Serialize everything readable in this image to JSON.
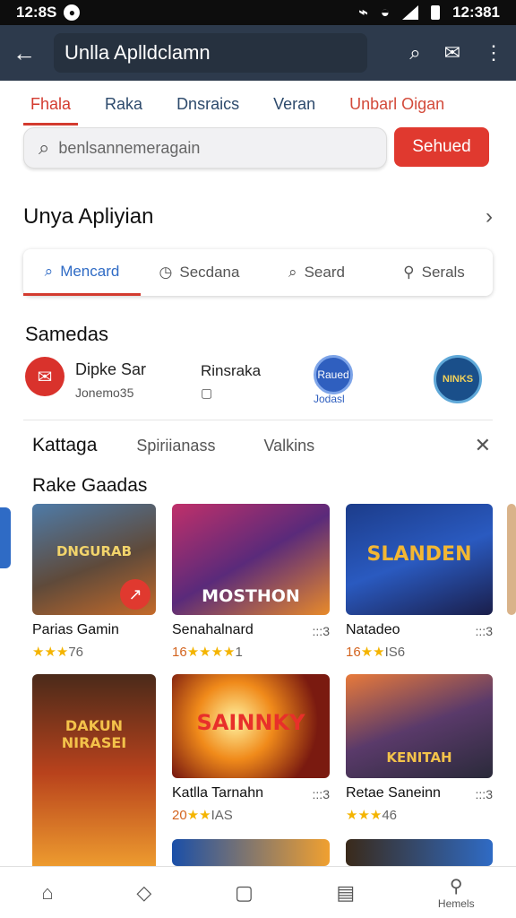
{
  "status": {
    "time_left": "12:8S",
    "time_right": "12:381"
  },
  "appbar": {
    "title": "Unlla Aplldclamn"
  },
  "tabs": [
    {
      "label": "Fhala",
      "active": true
    },
    {
      "label": "Raka"
    },
    {
      "label": "Dnsraics"
    },
    {
      "label": "Veran"
    },
    {
      "label": "Unbarl Oigan",
      "red": true
    }
  ],
  "search": {
    "value": "benlsannemeragain",
    "button": "Sehued"
  },
  "section1": {
    "title": "Unya Apliyian"
  },
  "segments": [
    {
      "label": "Mencard",
      "icon": "search-icon",
      "active": true
    },
    {
      "label": "Secdana",
      "icon": "clock-icon"
    },
    {
      "label": "Seard",
      "icon": "search-icon"
    },
    {
      "label": "Serals",
      "icon": "user-icon"
    }
  ],
  "games_title": "Samedas",
  "games_row": [
    {
      "name": "Dipke Sar",
      "sub": "Jonemo35",
      "color": "#d9322c"
    },
    {
      "name": "Rinsraka",
      "sub": "",
      "color": ""
    },
    {
      "name": "Raued",
      "sub": "Jodasl",
      "color": "#2f5fbf"
    },
    {
      "name": "NINKS",
      "sub": "",
      "color": "#1a4f8a"
    }
  ],
  "categories": {
    "first": "Kattaga",
    "items": [
      "Spiriianass",
      "Valkins"
    ]
  },
  "rake_title": "Rake Gaadas",
  "cards": [
    {
      "thumb_text": "DNGURAB",
      "name": "Parias Gamin",
      "rating_num": "",
      "rating_suffix": "76",
      "dots": ""
    },
    {
      "thumb_text": "MOSTHON",
      "name": "Senahalnard",
      "rating_num": "16",
      "rating_suffix": "1",
      "dots": ":::3"
    },
    {
      "thumb_text": "SLANDEN",
      "name": "Natadeo",
      "rating_num": "16",
      "rating_suffix": "IS6",
      "dots": ":::3"
    },
    {
      "thumb_text": "DAKUN NIRASEI",
      "name": "",
      "rating_num": "",
      "rating_suffix": "",
      "dots": ""
    },
    {
      "thumb_text": "SAINNKY",
      "name": "Katlla Tarnahn",
      "rating_num": "20",
      "rating_suffix": "IAS",
      "dots": ":::3"
    },
    {
      "thumb_text": "KENITAH",
      "name": "Retae Saneinn",
      "rating_num": "",
      "rating_suffix": "46",
      "dots": ":::3"
    }
  ],
  "nav": {
    "last_label": "Hemels"
  }
}
